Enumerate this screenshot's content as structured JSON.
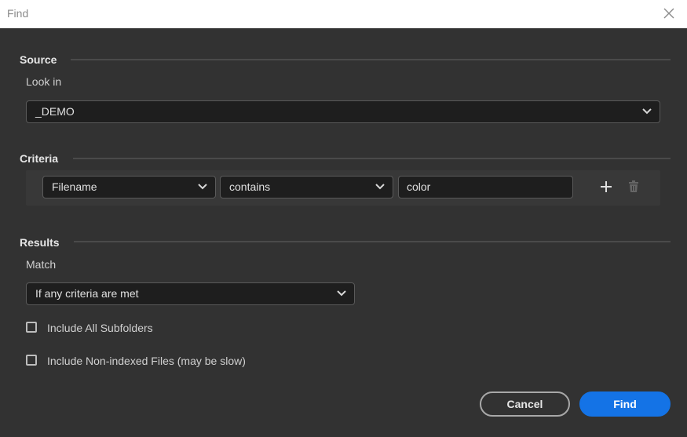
{
  "window": {
    "title": "Find"
  },
  "source": {
    "heading": "Source",
    "look_in_label": "Look in",
    "look_in_value": "_DEMO"
  },
  "criteria": {
    "heading": "Criteria",
    "field": "Filename",
    "operator": "contains",
    "value": "color"
  },
  "results": {
    "heading": "Results",
    "match_label": "Match",
    "match_value": "If any criteria are met",
    "include_subfolders_label": "Include All Subfolders",
    "include_subfolders_checked": false,
    "include_nonindexed_label": "Include Non-indexed Files (may be slow)",
    "include_nonindexed_checked": false
  },
  "buttons": {
    "cancel": "Cancel",
    "find": "Find"
  },
  "colors": {
    "accent": "#1473e6",
    "background": "#323232",
    "field_background": "#1e1e1e"
  }
}
